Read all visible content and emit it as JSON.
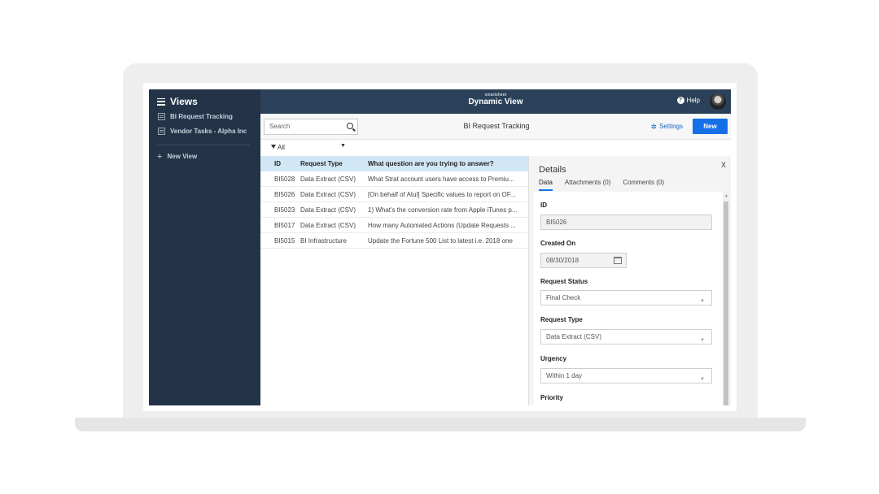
{
  "sidebar": {
    "title": "Views",
    "items": [
      {
        "label": "BI Request Tracking",
        "icon": "sheet-icon"
      },
      {
        "label": "Vendor Tasks - Alpha Inc",
        "icon": "sheet-icon"
      }
    ],
    "new_view_label": "New View"
  },
  "topbar": {
    "brand_small": "smartsheet",
    "brand_name": "Dynamic View",
    "help_label": "Help"
  },
  "toolbar": {
    "search_placeholder": "Search",
    "sheet_title": "BI Request Tracking",
    "settings_label": "Settings",
    "new_label": "New"
  },
  "filter": {
    "label": "All"
  },
  "grid": {
    "columns": [
      "ID",
      "Request Type",
      "What question are you trying to answer?"
    ],
    "rows": [
      {
        "id": "BI5028",
        "type": "Data Extract (CSV)",
        "question": "What Strat account users have access to Premiu..."
      },
      {
        "id": "BI5026",
        "type": "Data Extract (CSV)",
        "question": "[On behalf of Atul] Specific values to report on OF..."
      },
      {
        "id": "BI5023",
        "type": "Data Extract (CSV)",
        "question": "1) What's the conversion rate from Apple iTunes p..."
      },
      {
        "id": "BI5017",
        "type": "Data Extract (CSV)",
        "question": "How many Automated Actions (Update Requests ..."
      },
      {
        "id": "BI5015",
        "type": "BI Infrastructure",
        "question": "Update the Fortune 500 List to latest i.e. 2018 one"
      }
    ]
  },
  "details": {
    "title": "Details",
    "close": "X",
    "tabs": [
      "Data",
      "Attachments (0)",
      "Comments (0)"
    ],
    "fields": {
      "id_label": "ID",
      "id_value": "BI5026",
      "created_label": "Created On",
      "created_value": "08/30/2018",
      "status_label": "Request Status",
      "status_value": "Final Check",
      "type_label": "Request Type",
      "type_value": "Data Extract (CSV)",
      "urgency_label": "Urgency",
      "urgency_value": "Within 1 day",
      "priority_label": "Priority"
    }
  },
  "colors": {
    "sidebar": "#233449",
    "topbar": "#2b4159",
    "accent": "#1570e8",
    "grid_header": "#d2e7f6"
  }
}
